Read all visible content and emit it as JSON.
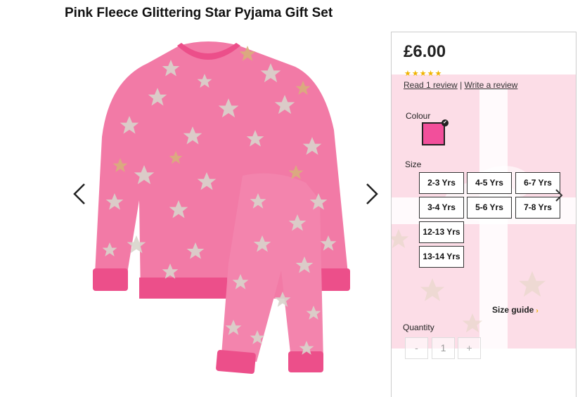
{
  "product": {
    "title": "Pink Fleece Glittering Star Pyjama Gift Set",
    "price": "£6.00",
    "rating_stars": "★★★★★",
    "read_review": "Read 1 review",
    "separator": "|",
    "write_review": "Write a review"
  },
  "colour": {
    "label": "Colour",
    "selected_hex": "#f24f9b",
    "check_icon": "✔"
  },
  "size": {
    "label": "Size",
    "options": [
      "2-3 Yrs",
      "4-5 Yrs",
      "6-7 Yrs",
      "3-4 Yrs",
      "5-6 Yrs",
      "7-8 Yrs",
      "12-13 Yrs",
      "13-14 Yrs"
    ],
    "guide": "Size guide",
    "guide_icon": "›"
  },
  "quantity": {
    "label": "Quantity",
    "minus": "-",
    "value": "1",
    "plus": "+"
  },
  "colors": {
    "pink": "#f27aa6",
    "pink_light": "#f9b9cf",
    "pink_dark": "#ec4f8a",
    "gold": "#d8b27a",
    "silver": "#d9d4cc",
    "rating": "#f0b400"
  },
  "icons": [
    "chevron-left-icon",
    "chevron-right-icon",
    "check-icon",
    "chevron-right-small-icon"
  ]
}
